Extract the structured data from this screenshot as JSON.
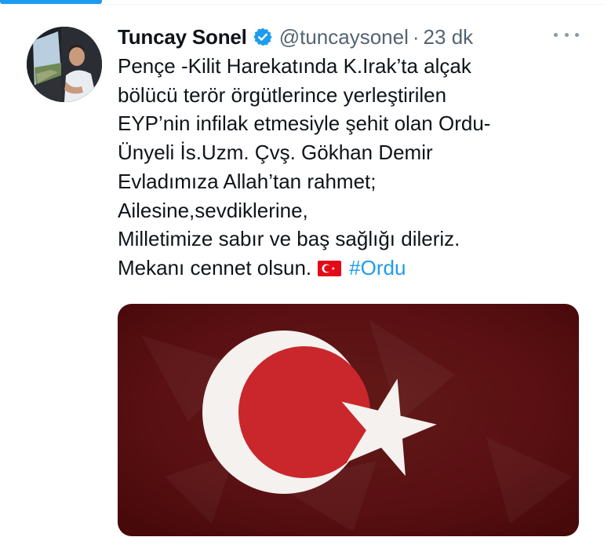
{
  "tweet": {
    "author_name": "Tuncay Sonel",
    "author_handle": "@tuncaysonel",
    "separator": "·",
    "timestamp": "23 dk",
    "verified": true,
    "lines": [
      "Pençe -Kilit Harekatında K.Irak’ta alçak",
      "bölücü terör örgütlerince yerleştirilen",
      "EYP’nin infilak etmesiyle şehit olan Ordu-",
      "Ünyeli İs.Uzm. Çvş. Gökhan Demir",
      "Evladımıza Allah’tan rahmet;",
      "Ailesine,sevdiklerine,",
      "Milletimize sabır ve baş sağlığı dileriz."
    ],
    "last_line_text": "Mekanı cennet olsun.",
    "hashtag": "#Ordu",
    "media": {
      "type": "image",
      "subject": "turkish-flag-icon"
    }
  },
  "colors": {
    "accent": "#1d9bf0",
    "secondary_text": "#536471",
    "flag_red": "#d42a2a"
  },
  "icons": {
    "verified": "verified-badge-icon",
    "more": "more-options-icon",
    "flag": "turkish-flag-emoji-icon"
  }
}
